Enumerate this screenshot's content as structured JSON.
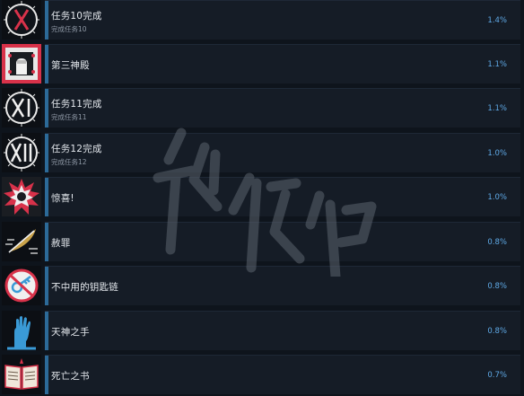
{
  "achievements": [
    {
      "title": "任务10完成",
      "desc": "完成任务10",
      "percent": "1.4%",
      "icon": "roman-x-icon",
      "progress": 0.014
    },
    {
      "title": "第三神殿",
      "desc": "",
      "percent": "1.1%",
      "icon": "temple-fist-icon",
      "progress": 0.011
    },
    {
      "title": "任务11完成",
      "desc": "完成任务11",
      "percent": "1.1%",
      "icon": "roman-xi-icon",
      "progress": 0.011
    },
    {
      "title": "任务12完成",
      "desc": "完成任务12",
      "percent": "1.0%",
      "icon": "roman-xii-icon",
      "progress": 0.01
    },
    {
      "title": "惊喜!",
      "desc": "",
      "percent": "1.0%",
      "icon": "surprise-explosion-icon",
      "progress": 0.01
    },
    {
      "title": "赦罪",
      "desc": "",
      "percent": "0.8%",
      "icon": "feather-icon",
      "progress": 0.008
    },
    {
      "title": "不中用的钥匙链",
      "desc": "",
      "percent": "0.8%",
      "icon": "broken-keychain-icon",
      "progress": 0.008
    },
    {
      "title": "天神之手",
      "desc": "",
      "percent": "0.8%",
      "icon": "raised-hand-icon",
      "progress": 0.008
    },
    {
      "title": "死亡之书",
      "desc": "",
      "percent": "0.7%",
      "icon": "book-of-death-icon",
      "progress": 0.007
    }
  ],
  "colors": {
    "background": "#0e141c",
    "panel": "#151c26",
    "percent": "#5fa9e6",
    "icon_red": "#c8304a",
    "icon_blue": "#3a9ad6"
  }
}
